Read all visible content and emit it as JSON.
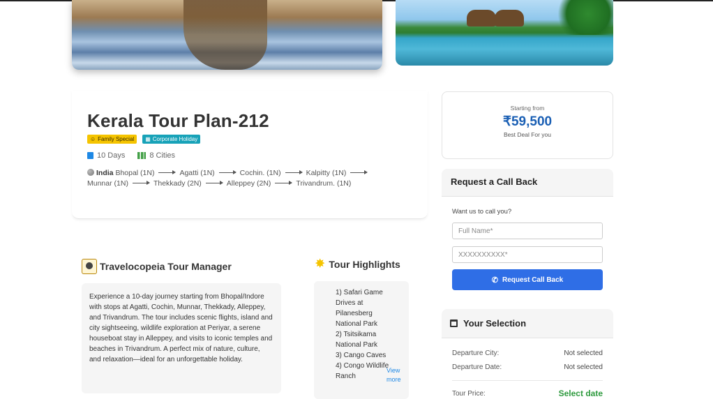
{
  "tour": {
    "title": "Kerala Tour Plan-212",
    "badges": [
      {
        "label": "Family Special",
        "icon": "family-icon",
        "color": "#f5c400"
      },
      {
        "label": "Corporate Holiday",
        "icon": "building-icon",
        "color": "#17a2b8"
      }
    ],
    "duration": "10 Days",
    "cities": "8 Cities",
    "country": "India",
    "route": [
      "Bhopal (1N)",
      "Agatti (1N)",
      "Cochin. (1N)",
      "Kalpitty (1N)",
      "Munnar (1N)",
      "Thekkady (2N)",
      "Alleppey (2N)",
      "Trivandrum. (1N)"
    ]
  },
  "manager": {
    "heading": "Travelocopeia Tour Manager",
    "description": "Experience a 10-day journey starting from Bhopal/Indore with stops at Agatti, Cochin, Munnar, Thekkady, Alleppey, and Trivandrum. The tour includes scenic flights, island and city sightseeing, wildlife exploration at Periyar, a serene houseboat stay in Alleppey, and visits to iconic temples and beaches in Trivandrum. A perfect mix of nature, culture, and relaxation—ideal for an unforgettable holiday."
  },
  "highlights": {
    "heading": "Tour Highlights",
    "items": [
      "1) Safari Game Drives at Pilanesberg National Park",
      "2) Tsitsikama National Park",
      "3) Cango Caves",
      "4) Congo Wildlife Ranch"
    ],
    "view_more": "View more"
  },
  "price": {
    "starting_from": "Starting from",
    "amount": "₹59,500",
    "deal": "Best Deal For you"
  },
  "callback": {
    "heading": "Request a Call Back",
    "prompt": "Want us to call you?",
    "name_placeholder": "Full Name*",
    "phone_placeholder": "XXXXXXXXXX*",
    "button_label": "Request Call Back"
  },
  "selection": {
    "heading": "Your Selection",
    "departure_city_label": "Departure City:",
    "departure_city_value": "Not selected",
    "departure_date_label": "Departure Date:",
    "departure_date_value": "Not selected",
    "tour_price_label": "Tour Price:",
    "tour_price_value": "Select date"
  },
  "colors": {
    "accent": "#2f6ee6",
    "price": "#1a5fb4",
    "success": "#2e9a3e"
  }
}
